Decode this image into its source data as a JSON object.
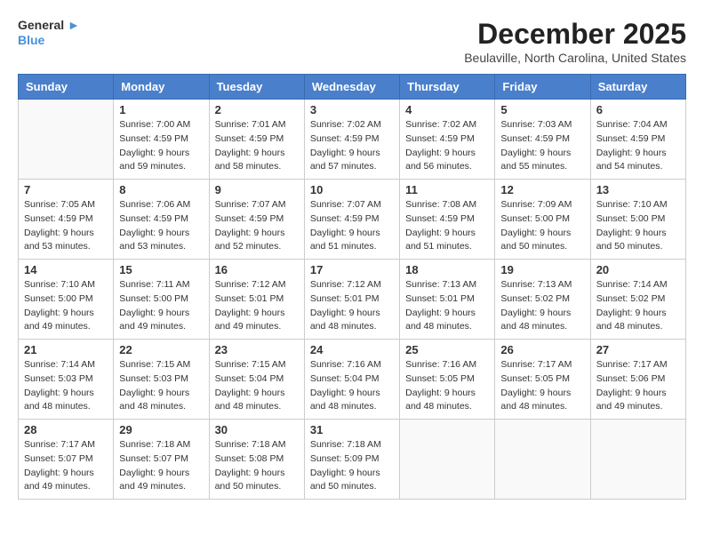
{
  "header": {
    "logo_general": "General",
    "logo_blue": "Blue",
    "month_title": "December 2025",
    "location": "Beulaville, North Carolina, United States"
  },
  "weekdays": [
    "Sunday",
    "Monday",
    "Tuesday",
    "Wednesday",
    "Thursday",
    "Friday",
    "Saturday"
  ],
  "weeks": [
    [
      {
        "day": "",
        "info": ""
      },
      {
        "day": "1",
        "info": "Sunrise: 7:00 AM\nSunset: 4:59 PM\nDaylight: 9 hours\nand 59 minutes."
      },
      {
        "day": "2",
        "info": "Sunrise: 7:01 AM\nSunset: 4:59 PM\nDaylight: 9 hours\nand 58 minutes."
      },
      {
        "day": "3",
        "info": "Sunrise: 7:02 AM\nSunset: 4:59 PM\nDaylight: 9 hours\nand 57 minutes."
      },
      {
        "day": "4",
        "info": "Sunrise: 7:02 AM\nSunset: 4:59 PM\nDaylight: 9 hours\nand 56 minutes."
      },
      {
        "day": "5",
        "info": "Sunrise: 7:03 AM\nSunset: 4:59 PM\nDaylight: 9 hours\nand 55 minutes."
      },
      {
        "day": "6",
        "info": "Sunrise: 7:04 AM\nSunset: 4:59 PM\nDaylight: 9 hours\nand 54 minutes."
      }
    ],
    [
      {
        "day": "7",
        "info": ""
      },
      {
        "day": "8",
        "info": "Sunrise: 7:06 AM\nSunset: 4:59 PM\nDaylight: 9 hours\nand 53 minutes."
      },
      {
        "day": "9",
        "info": "Sunrise: 7:07 AM\nSunset: 4:59 PM\nDaylight: 9 hours\nand 52 minutes."
      },
      {
        "day": "10",
        "info": "Sunrise: 7:07 AM\nSunset: 4:59 PM\nDaylight: 9 hours\nand 51 minutes."
      },
      {
        "day": "11",
        "info": "Sunrise: 7:08 AM\nSunset: 4:59 PM\nDaylight: 9 hours\nand 51 minutes."
      },
      {
        "day": "12",
        "info": "Sunrise: 7:09 AM\nSunset: 5:00 PM\nDaylight: 9 hours\nand 50 minutes."
      },
      {
        "day": "13",
        "info": "Sunrise: 7:10 AM\nSunset: 5:00 PM\nDaylight: 9 hours\nand 50 minutes."
      }
    ],
    [
      {
        "day": "14",
        "info": ""
      },
      {
        "day": "15",
        "info": "Sunrise: 7:11 AM\nSunset: 5:00 PM\nDaylight: 9 hours\nand 49 minutes."
      },
      {
        "day": "16",
        "info": "Sunrise: 7:12 AM\nSunset: 5:01 PM\nDaylight: 9 hours\nand 49 minutes."
      },
      {
        "day": "17",
        "info": "Sunrise: 7:12 AM\nSunset: 5:01 PM\nDaylight: 9 hours\nand 48 minutes."
      },
      {
        "day": "18",
        "info": "Sunrise: 7:13 AM\nSunset: 5:01 PM\nDaylight: 9 hours\nand 48 minutes."
      },
      {
        "day": "19",
        "info": "Sunrise: 7:13 AM\nSunset: 5:02 PM\nDaylight: 9 hours\nand 48 minutes."
      },
      {
        "day": "20",
        "info": "Sunrise: 7:14 AM\nSunset: 5:02 PM\nDaylight: 9 hours\nand 48 minutes."
      }
    ],
    [
      {
        "day": "21",
        "info": ""
      },
      {
        "day": "22",
        "info": "Sunrise: 7:15 AM\nSunset: 5:03 PM\nDaylight: 9 hours\nand 48 minutes."
      },
      {
        "day": "23",
        "info": "Sunrise: 7:15 AM\nSunset: 5:04 PM\nDaylight: 9 hours\nand 48 minutes."
      },
      {
        "day": "24",
        "info": "Sunrise: 7:16 AM\nSunset: 5:04 PM\nDaylight: 9 hours\nand 48 minutes."
      },
      {
        "day": "25",
        "info": "Sunrise: 7:16 AM\nSunset: 5:05 PM\nDaylight: 9 hours\nand 48 minutes."
      },
      {
        "day": "26",
        "info": "Sunrise: 7:17 AM\nSunset: 5:05 PM\nDaylight: 9 hours\nand 48 minutes."
      },
      {
        "day": "27",
        "info": "Sunrise: 7:17 AM\nSunset: 5:06 PM\nDaylight: 9 hours\nand 49 minutes."
      }
    ],
    [
      {
        "day": "28",
        "info": "Sunrise: 7:17 AM\nSunset: 5:07 PM\nDaylight: 9 hours\nand 49 minutes."
      },
      {
        "day": "29",
        "info": "Sunrise: 7:18 AM\nSunset: 5:07 PM\nDaylight: 9 hours\nand 49 minutes."
      },
      {
        "day": "30",
        "info": "Sunrise: 7:18 AM\nSunset: 5:08 PM\nDaylight: 9 hours\nand 50 minutes."
      },
      {
        "day": "31",
        "info": "Sunrise: 7:18 AM\nSunset: 5:09 PM\nDaylight: 9 hours\nand 50 minutes."
      },
      {
        "day": "",
        "info": ""
      },
      {
        "day": "",
        "info": ""
      },
      {
        "day": "",
        "info": ""
      }
    ]
  ],
  "week1_day7_info": "Sunrise: 7:05 AM\nSunset: 4:59 PM\nDaylight: 9 hours\nand 53 minutes.",
  "week2_day14_info": "Sunrise: 7:10 AM\nSunset: 5:00 PM\nDaylight: 9 hours\nand 49 minutes.",
  "week3_day21_info": "Sunrise: 7:14 AM\nSunset: 5:03 PM\nDaylight: 9 hours\nand 48 minutes."
}
